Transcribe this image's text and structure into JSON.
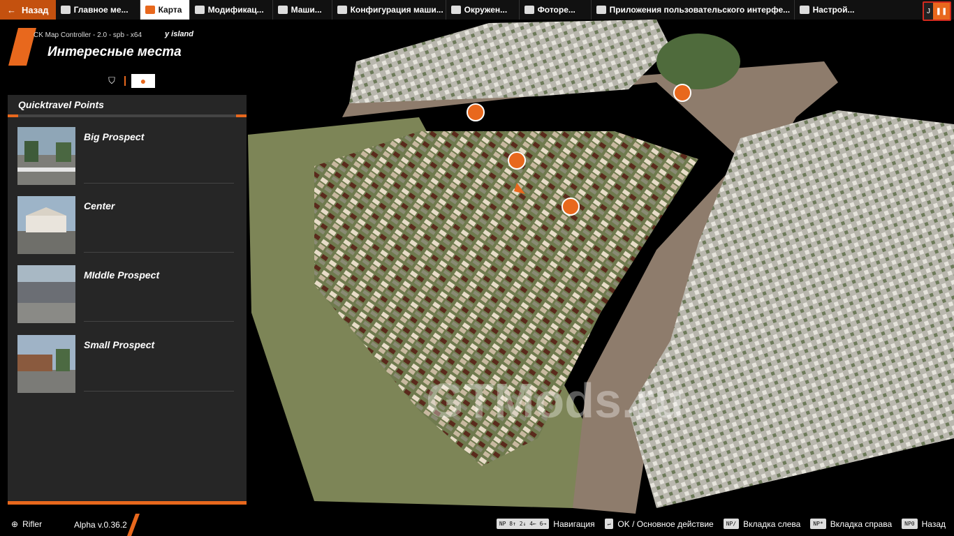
{
  "topbar": {
    "back_label": "Назад",
    "tabs": [
      {
        "label": "Главное ме...",
        "icon": "main-menu-icon"
      },
      {
        "label": "Карта",
        "icon": "map-icon",
        "active": true
      },
      {
        "label": "Модификац...",
        "icon": "puzzle-icon"
      },
      {
        "label": "Маши...",
        "icon": "car-icon"
      },
      {
        "label": "Конфигурация маши...",
        "icon": "car-config-icon"
      },
      {
        "label": "Окружен...",
        "icon": "weather-icon"
      },
      {
        "label": "Фоторе...",
        "icon": "camera-icon"
      },
      {
        "label": "Приложения пользовательского интерфе...",
        "icon": "apps-icon"
      },
      {
        "label": "Настрой...",
        "icon": "settings-icon"
      }
    ],
    "right_key": "J"
  },
  "header": {
    "subtitle": "CK Map Controller - 2.0 - spb - x64",
    "island": "y island",
    "title": "Интересные места"
  },
  "panel": {
    "heading": "Quicktravel Points",
    "items": [
      {
        "name": "Big Prospect"
      },
      {
        "name": "Center"
      },
      {
        "name": "MIddle Prospect"
      },
      {
        "name": "Small Prospect"
      }
    ]
  },
  "bottom": {
    "user": "Rifler",
    "version": "Alpha v.0.36.2",
    "hints": [
      {
        "key": "NP 8↑ 2↓ 4← 6→",
        "label": "Навигация"
      },
      {
        "key": "↵",
        "label": "OK / Основное действие"
      },
      {
        "key": "NP/",
        "label": "Вкладка слева"
      },
      {
        "key": "NP*",
        "label": "Вкладка справа"
      },
      {
        "key": "NP0",
        "label": "Назад"
      }
    ]
  },
  "map": {
    "watermark": "GTMods.ru",
    "markers": 4
  },
  "colors": {
    "accent": "#e8681d",
    "panel": "#262626",
    "river": "#8e7c6c"
  }
}
